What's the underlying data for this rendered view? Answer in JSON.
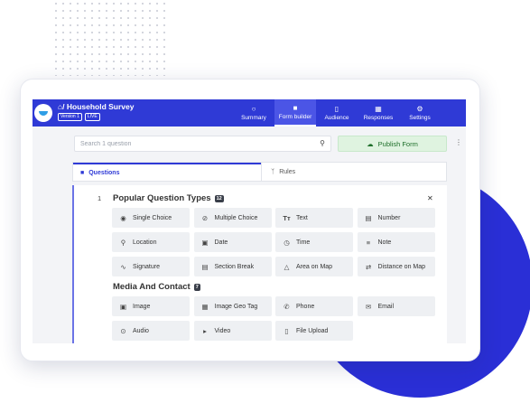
{
  "header": {
    "home_icon": "home-icon",
    "title": "/ Household Survey",
    "badges": [
      "Version 1",
      "LIVE"
    ],
    "nav": [
      {
        "label": "Summary",
        "icon": "summary-icon"
      },
      {
        "label": "Form builder",
        "icon": "form-builder-icon",
        "active": true
      },
      {
        "label": "Audience",
        "icon": "audience-icon"
      },
      {
        "label": "Responses",
        "icon": "responses-icon"
      },
      {
        "label": "Settings",
        "icon": "settings-icon"
      }
    ]
  },
  "search": {
    "placeholder": "Search 1 question"
  },
  "publish": {
    "label": "Publish Form",
    "icon": "cloud-upload-icon"
  },
  "tabs": {
    "questions": "Questions",
    "rules": "Rules"
  },
  "question": {
    "number": "1",
    "popular": {
      "title": "Popular Question Types",
      "count": "12",
      "items": [
        "Single Choice",
        "Multiple Choice",
        "Text",
        "Number",
        "Location",
        "Date",
        "Time",
        "Note",
        "Signature",
        "Section Break",
        "Area on Map",
        "Distance on Map"
      ]
    },
    "media": {
      "title": "Media And Contact",
      "count": "7",
      "items": [
        "Image",
        "Image Geo Tag",
        "Phone",
        "Email",
        "Audio",
        "Video",
        "File Upload"
      ]
    }
  },
  "colors": {
    "accent": "#2f3ad6",
    "publish_bg": "#dff3e0",
    "publish_text": "#1e6e2a"
  }
}
